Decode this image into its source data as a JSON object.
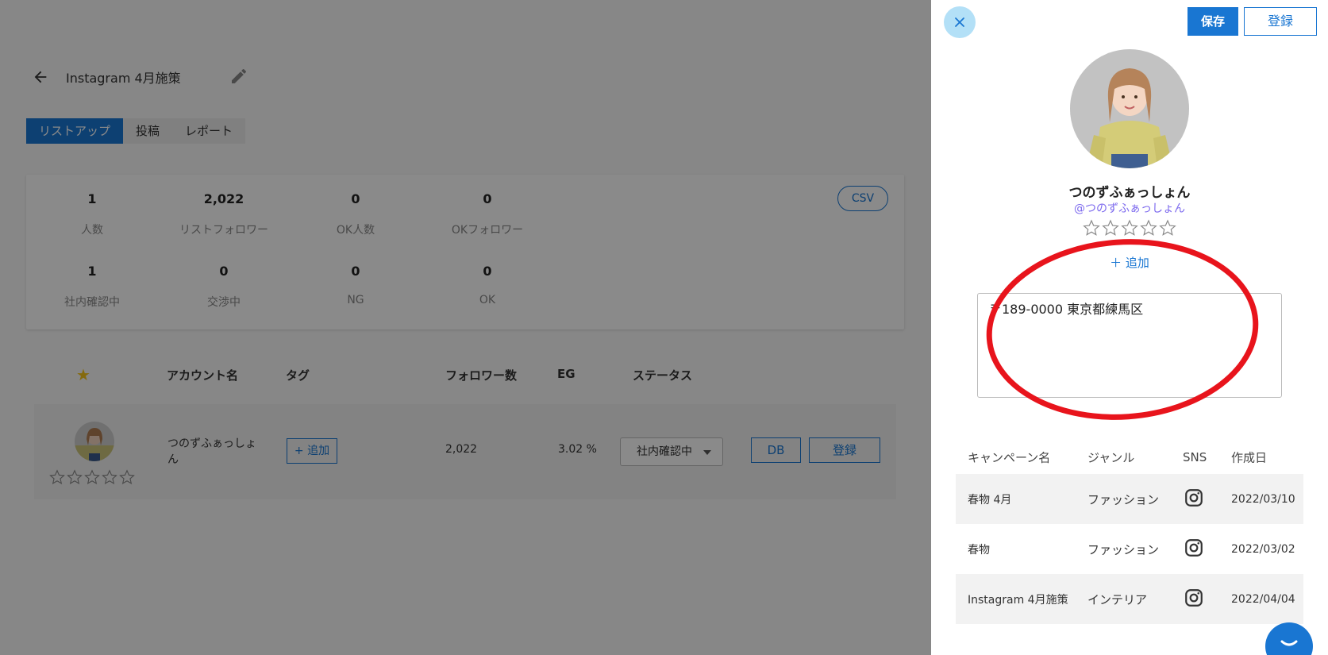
{
  "page": {
    "title": "Instagram 4月施策",
    "tabs": [
      {
        "label": "リストアップ",
        "active": true
      },
      {
        "label": "投稿",
        "active": false
      },
      {
        "label": "レポート",
        "active": false
      }
    ],
    "csv_label": "CSV",
    "stats": [
      {
        "value": "1",
        "label": "人数"
      },
      {
        "value": "2,022",
        "label": "リストフォロワー"
      },
      {
        "value": "0",
        "label": "OK人数"
      },
      {
        "value": "0",
        "label": "OKフォロワー"
      },
      {
        "value": "1",
        "label": "社内確認中"
      },
      {
        "value": "0",
        "label": "交渉中"
      },
      {
        "value": "0",
        "label": "NG"
      },
      {
        "value": "0",
        "label": "OK"
      }
    ],
    "table_headers": {
      "star": "★",
      "account": "アカウント名",
      "tag": "タグ",
      "followers": "フォロワー数",
      "eg": "EG",
      "status": "ステータス"
    },
    "row": {
      "name": "つのずふぁっしょん",
      "add_tag": "+ 追加",
      "followers": "2,022",
      "eg": "3.02 %",
      "status": "社内確認中",
      "db_label": "DB",
      "register_label": "登録",
      "rating_stars": 0
    }
  },
  "drawer": {
    "save_label": "保存",
    "register_label": "登録",
    "name": "つのずふぁっしょん",
    "handle": "@つのずふぁっしょん",
    "rating_stars": 0,
    "add_label": "＋ 追加",
    "memo": "〒189-0000 東京都練馬区",
    "campaign_headers": {
      "name": "キャンペーン名",
      "genre": "ジャンル",
      "sns": "SNS",
      "created": "作成日"
    },
    "campaigns": [
      {
        "name": "春物 4月",
        "genre": "ファッション",
        "sns_icon": "instagram-icon",
        "created": "2022/03/10"
      },
      {
        "name": "春物",
        "genre": "ファッション",
        "sns_icon": "instagram-icon",
        "created": "2022/03/02"
      },
      {
        "name": "Instagram 4月施策",
        "genre": "インテリア",
        "sns_icon": "instagram-icon",
        "created": "2022/04/04"
      }
    ]
  },
  "colors": {
    "primary": "#1976d2",
    "handle": "#7b68ee",
    "star_gold": "#f5c518",
    "annotation_red": "#e8141c"
  }
}
